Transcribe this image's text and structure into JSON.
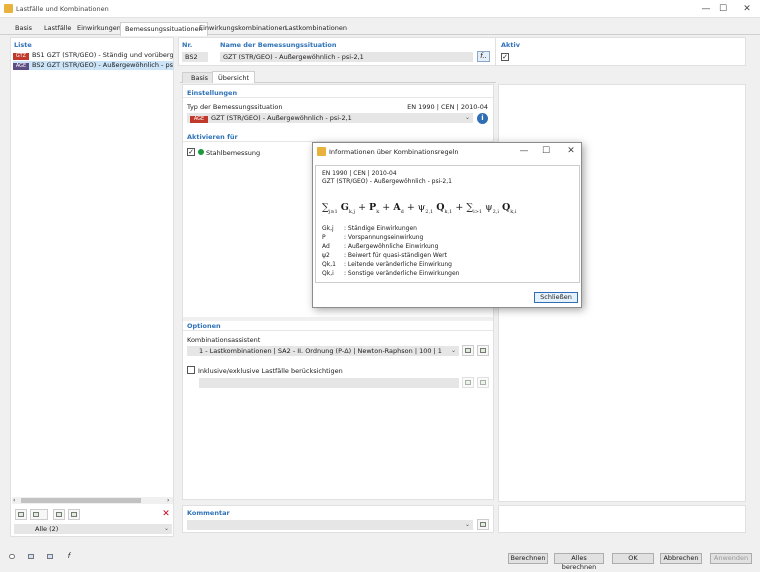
{
  "window": {
    "title": "Lastfälle und Kombinationen",
    "min": "—",
    "max": "☐",
    "close": "✕"
  },
  "tabs": [
    "Basis",
    "Lastfälle",
    "Einwirkungen",
    "Bemessungssituationen",
    "Einwirkungskombinationen",
    "Lastkombinationen"
  ],
  "list": {
    "header": "Liste",
    "items": [
      {
        "tag": "GTZ",
        "tag_color": "#c0392b",
        "label": "BS1  GZT (STR/GEO) - Ständig und vorübergehend"
      },
      {
        "tag": "AGE",
        "tag_color": "#5e4d82",
        "label": "BS2  GZT (STR/GEO) - Außergewöhnlich - psi-2,1"
      }
    ],
    "filter_value": "Alle (2)"
  },
  "nr": {
    "label": "Nr.",
    "value": "BS2"
  },
  "name": {
    "label": "Name der Bemessungssituation",
    "value": "GZT (STR/GEO) - Außergewöhnlich - psi-2,1"
  },
  "aktiv": {
    "label": "Aktiv"
  },
  "subtabs": [
    "Basis",
    "Übersicht"
  ],
  "einstellungen": {
    "header": "Einstellungen",
    "typ_label": "Typ der Bemessungssituation",
    "norm": "EN 1990 | CEN | 2010-04",
    "typ_tag": "AGE",
    "typ_value": "GZT (STR/GEO) - Außergewöhnlich - psi-2,1"
  },
  "aktivieren": {
    "header": "Aktivieren für",
    "item": "Stahlbemessung"
  },
  "optionen": {
    "header": "Optionen",
    "assist_label": "Kombinationsassistent",
    "assist_value": "1 - Lastkombinationen | SA2 - II. Ordnung (P-Δ) | Newton-Raphson | 100 | 1",
    "incl_label": "Inklusive/exklusive Lastfälle berücksichtigen"
  },
  "kommentar": {
    "header": "Kommentar"
  },
  "dialog": {
    "title": "Informationen über Kombinationsregeln",
    "line1": "EN 1990 | CEN | 2010-04",
    "line2": "GZT (STR/GEO) - Außergewöhnlich - psi-2,1",
    "legend": [
      {
        "sym": "Gk,j",
        "desc": ": Ständige Einwirkungen"
      },
      {
        "sym": "P",
        "desc": ": Vorspannungseinwirkung"
      },
      {
        "sym": "Ad",
        "desc": ": Außergewöhnliche Einwirkung"
      },
      {
        "sym": "ψ2",
        "desc": ": Beiwert für quasi-ständigen Wert"
      },
      {
        "sym": "Qk,1",
        "desc": ": Leitende veränderliche Einwirkung"
      },
      {
        "sym": "Qk,i",
        "desc": ": Sonstige veränderliche Einwirkungen"
      }
    ],
    "close_label": "Schließen"
  },
  "bottom": {
    "berechnen": "Berechnen",
    "alle_berechnen": "Alles berechnen",
    "ok": "OK",
    "abbrechen": "Abbrechen",
    "anwenden": "Anwenden"
  }
}
